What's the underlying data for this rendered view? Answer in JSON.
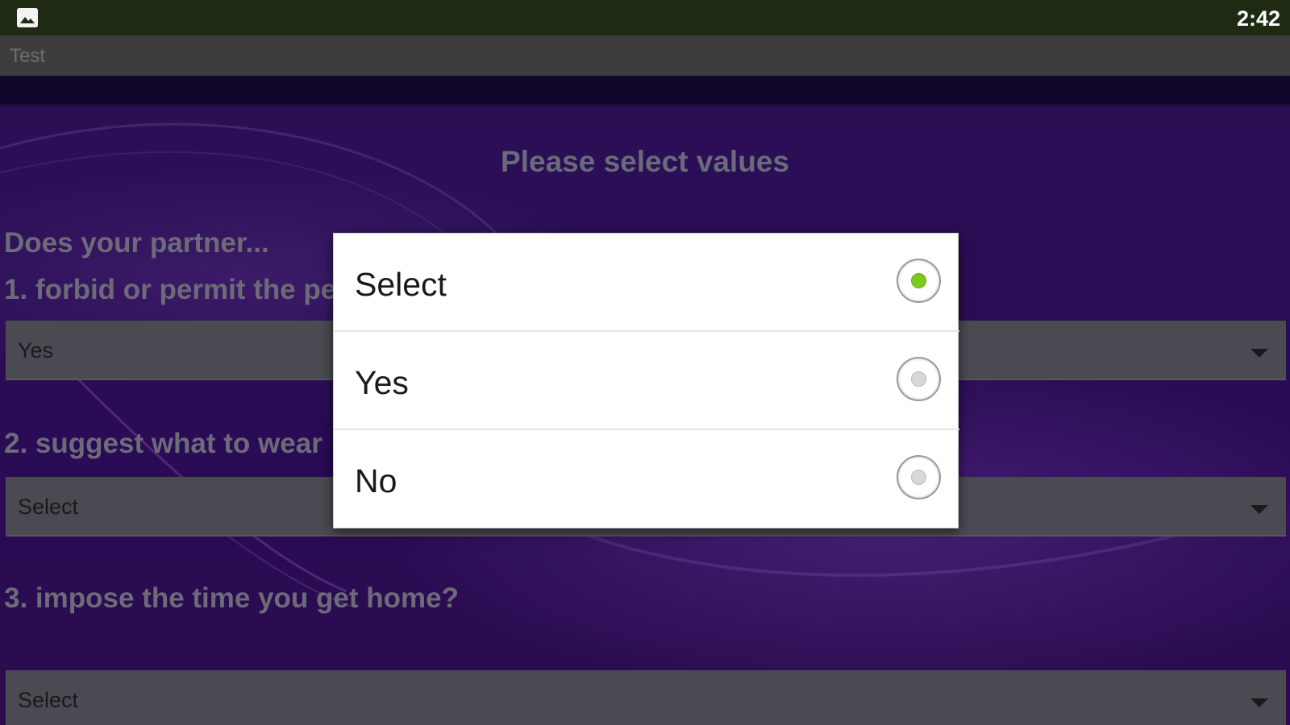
{
  "status_bar": {
    "notification_icon": "image-icon",
    "clock": "2:42"
  },
  "app_bar": {
    "title": "Test"
  },
  "form": {
    "heading": "Please select values",
    "intro": "Does your partner...",
    "questions": [
      {
        "label": "1. forbid or permit the pe",
        "value": "Yes"
      },
      {
        "label": "2. suggest what to wear",
        "value": "Select"
      },
      {
        "label": "3. impose the time you get home?",
        "value": "Select"
      }
    ]
  },
  "dialog": {
    "options": [
      {
        "label": "Select",
        "checked": true
      },
      {
        "label": "Yes",
        "checked": false
      },
      {
        "label": "No",
        "checked": false
      }
    ],
    "accent_color": "#7ccb1c"
  }
}
